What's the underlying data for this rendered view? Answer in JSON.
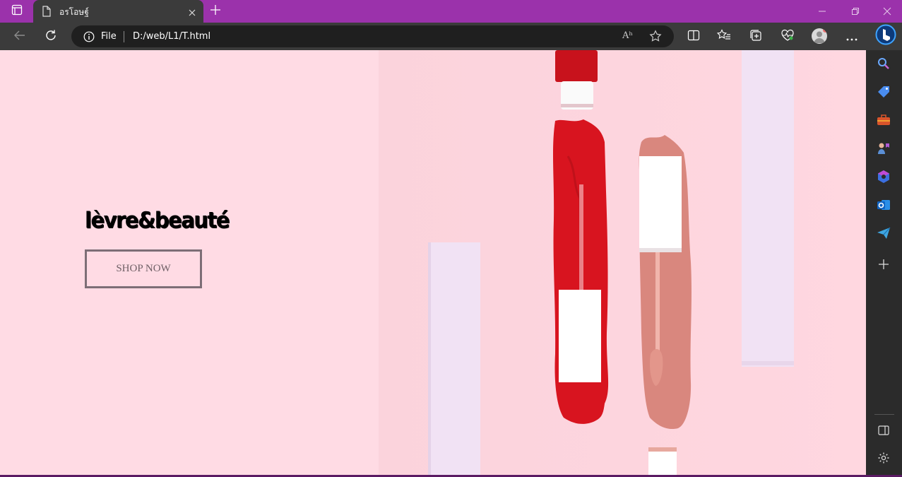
{
  "browser": {
    "tab_title": "อรโอษฐ์",
    "address": {
      "scheme_label": "File",
      "url": "D:/web/L1/T.html",
      "read_aloud_label": "Aʰ"
    },
    "colors": {
      "titlebar": "#9b32ab",
      "toolbar": "#3b3b3b",
      "omnibox": "#1f1f1f"
    }
  },
  "page": {
    "brand": "lèvre&beauté",
    "cta_label": "SHOP NOW",
    "colors": {
      "background": "#ffdbe4",
      "cta_border": "#7d6e76",
      "lipstick_red": "#d8141f",
      "lipstick_nude": "#d9877e"
    }
  },
  "sidebar": {
    "icons": [
      "search-icon",
      "shopping-tag-icon",
      "tools-icon",
      "games-icon",
      "office-icon",
      "outlook-icon",
      "send-icon",
      "add-icon",
      "sidebar-toggle-icon",
      "settings-icon"
    ]
  }
}
